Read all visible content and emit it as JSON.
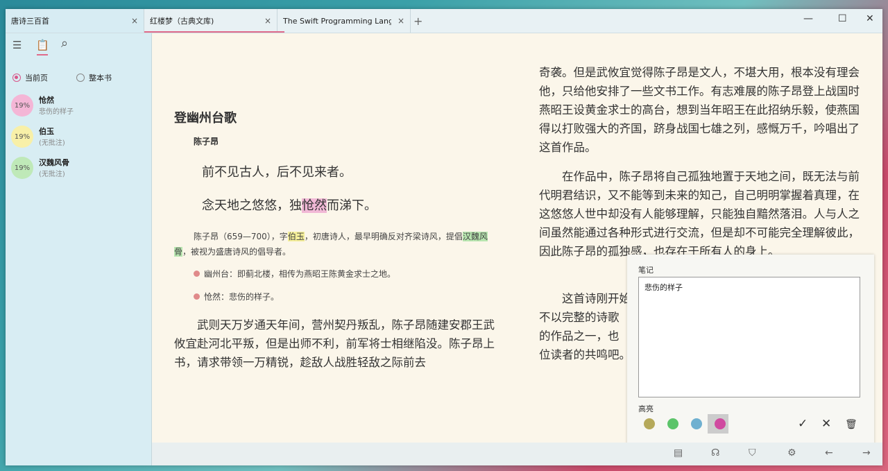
{
  "tabs": [
    {
      "label": "唐诗三百首",
      "close": "×"
    },
    {
      "label": "红楼梦（古典文库)",
      "close": "×"
    },
    {
      "label": "The Swift Programming Language (S",
      "close": "×"
    }
  ],
  "new_tab": "+",
  "window_controls": {
    "minimize": "—",
    "maximize": "☐",
    "close": "✕"
  },
  "sidebar": {
    "icons": {
      "toc": "☰",
      "notes": "📋",
      "search": "⌕"
    },
    "scope_current": "当前页",
    "scope_book": "整本书",
    "notes": [
      {
        "percent": "19%",
        "title": "怆然",
        "comment": "悲伤的样子",
        "color": "#f4b6d6"
      },
      {
        "percent": "19%",
        "title": "伯玉",
        "comment": "(无批注)",
        "color": "#f8f0a8"
      },
      {
        "percent": "19%",
        "title": "汉魏风骨",
        "comment": "(无批注)",
        "color": "#bfe9b8"
      }
    ]
  },
  "page": {
    "title": "登幽州台歌",
    "author": "陈子昂",
    "poem_line1": "前不见古人，后不见来者。",
    "poem_line2_a": "念天地之悠悠，独",
    "poem_line2_hl": "怆然",
    "poem_line2_b": "而涕下。",
    "bio_a": "陈子昂（659—700），字",
    "bio_hl1": "伯玉",
    "bio_b": "，初唐诗人，最早明确反对齐梁诗风，提倡",
    "bio_hl2": "汉魏风骨",
    "bio_c": "，被视为盛唐诗风的倡导者。",
    "footnote1": "幽州台：即蓟北楼，相传为燕昭王陈黄金求士之地。",
    "footnote2": "怆然：悲伤的样子。",
    "para_left": "武则天万岁通天年间，营州契丹叛乱，陈子昂随建安郡王武攸宜赴河北平叛，但是出师不利，前军将士相继陷没。陈子昂上书，请求带领一万精锐，趁敌人战胜轻敌之际前去",
    "para_right1": "奇袭。但是武攸宜觉得陈子昂是文人，不堪大用，根本没有理会他，只给他安排了一些文书工作。有志难展的陈子昂登上战国时燕昭王设黄金求士的高台，想到当年昭王在此招纳乐毅，使燕国得以打败强大的齐国，跻身战国七雄之列，感慨万千，吟唱出了这首作品。",
    "para_right2": "在作品中，陈子昂将自己孤独地置于天地之间，既无法与前代明君结识，又不能等到未来的知己，自己明明掌握着真理，在这悠悠人世中却没有人能够理解，只能独自黯然落泪。人与人之间虽然能通过各种形式进行交流，但是却不可能完全理解彼此，因此陈子昂的孤独感，也存在于所有人的身上。",
    "para_right3": "这首诗刚开始",
    "para_right3_l2": "不以完整的诗歌",
    "para_right3_l3": "的作品之一，也",
    "para_right3_l4": "位读者的共鸣吧。"
  },
  "note_panel": {
    "label_note": "笔记",
    "note_text": "悲伤的样子",
    "label_highlight": "高亮",
    "colors": [
      "#b5a95a",
      "#5cc46a",
      "#6fb0d0",
      "#d04aa0"
    ],
    "confirm": "✓",
    "cancel": "✕",
    "delete": "🗑"
  },
  "bottom_icons": {
    "page": "▤",
    "tts": "☊",
    "store": "⛉",
    "settings": "⚙",
    "prev": "←",
    "next": "→"
  }
}
